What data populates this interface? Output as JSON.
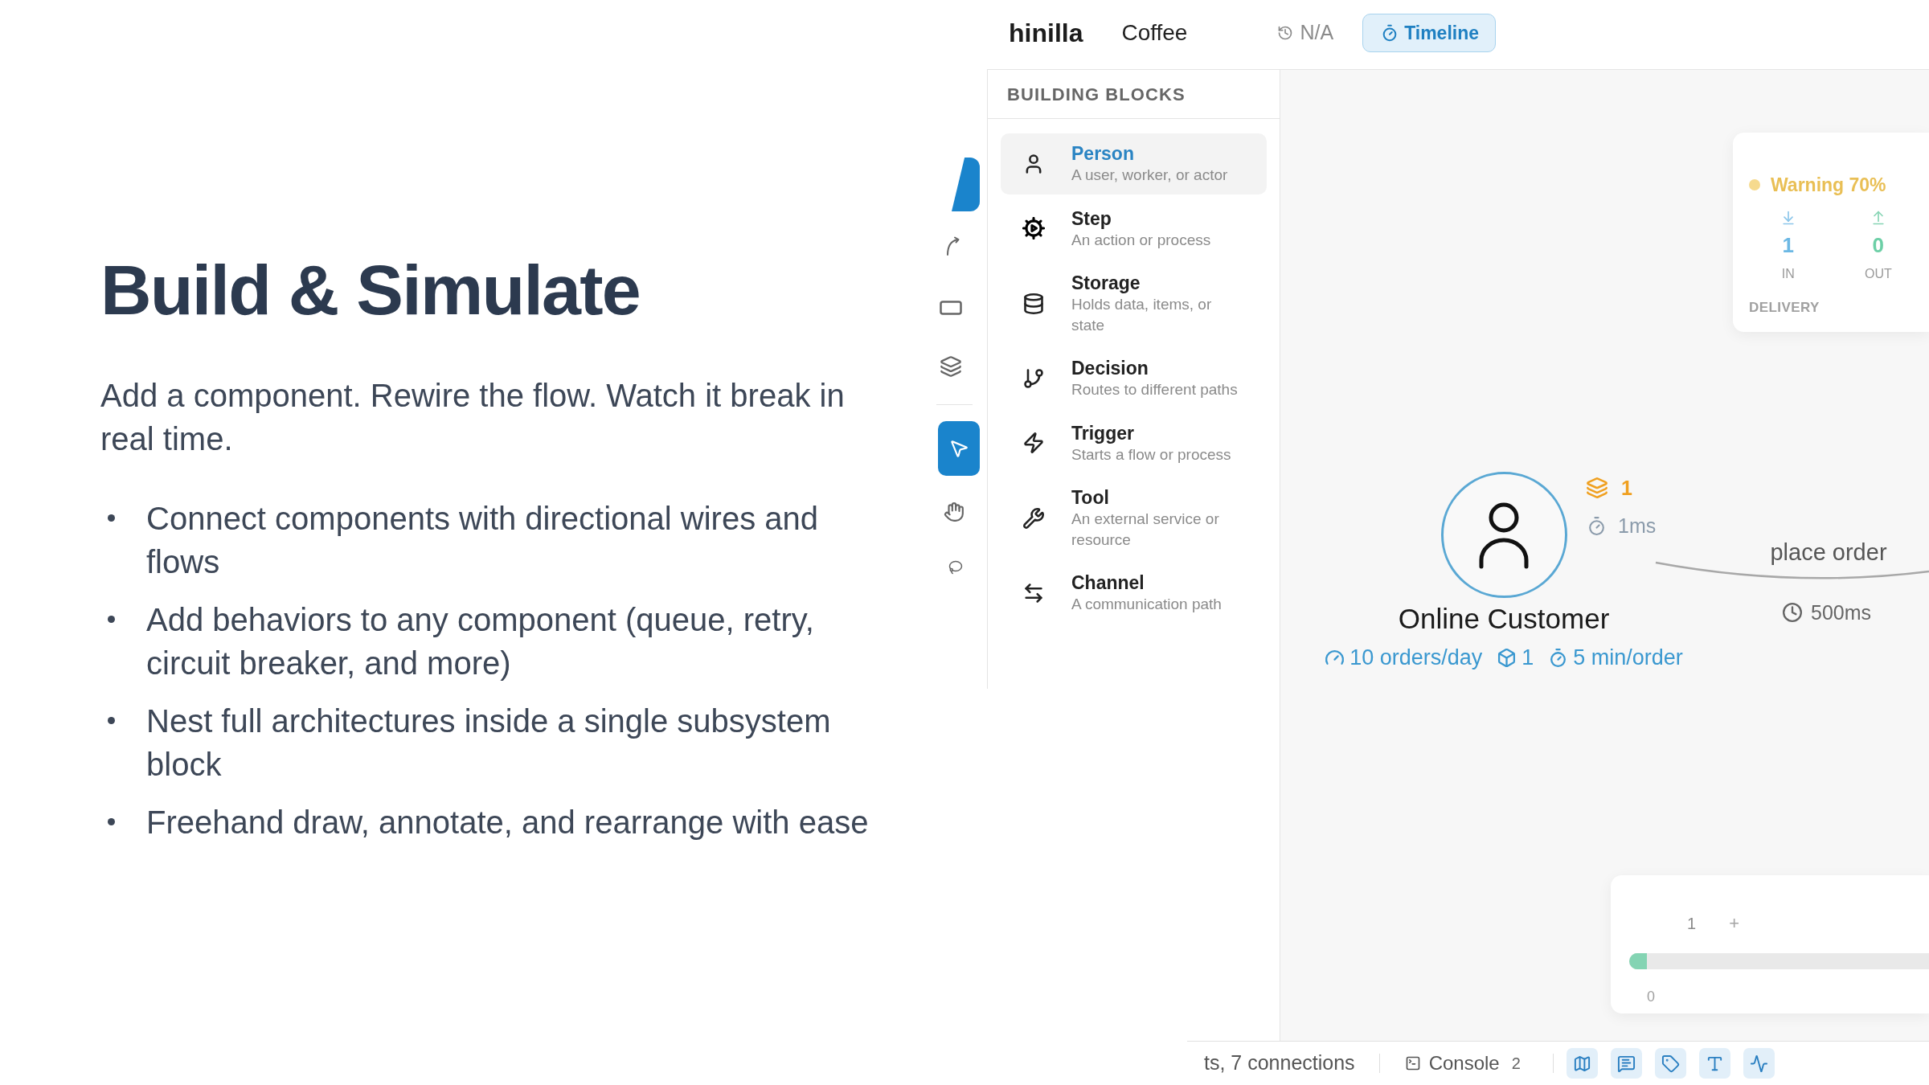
{
  "intro": {
    "title": "Build & Simulate",
    "lead": "Add a component. Rewire the flow. Watch it break in real time.",
    "bullets": [
      "Connect components with directional wires and flows",
      "Add behaviors to any component (queue, retry, circuit breaker, and more)",
      "Nest full architectures inside a single subsystem block",
      "Freehand draw, annotate, and rearrange with ease"
    ]
  },
  "app": {
    "top_bar": {
      "brand": "hinilla",
      "project": "Coffee",
      "history": "N/A",
      "timeline": {
        "label": "Timeline",
        "selected": true
      }
    },
    "toolbar": {
      "tools": [
        {
          "selected": true
        },
        {
          "selected": false
        },
        {
          "selected": false
        },
        {
          "selected": false
        },
        {
          "selected": true
        },
        {
          "selected": false
        },
        {
          "selected": false
        }
      ]
    },
    "building_blocks": {
      "title": "BUILDING BLOCKS",
      "items": [
        {
          "title": "Person",
          "description": "A user, worker, or actor",
          "selected": true
        },
        {
          "title": "Step",
          "description": "An action or process",
          "selected": false
        },
        {
          "title": "Storage",
          "description": "Holds data, items, or state",
          "selected": false
        },
        {
          "title": "Decision",
          "description": "Routes to different paths",
          "selected": false
        },
        {
          "title": "Trigger",
          "description": "Starts a flow or process",
          "selected": false
        },
        {
          "title": "Tool",
          "description": "An external service or resource",
          "selected": false
        },
        {
          "title": "Channel",
          "description": "A communication path",
          "selected": false
        }
      ]
    },
    "canvas": {
      "status_card": {
        "status": {
          "kind": "warning",
          "label": "Warning 70%"
        },
        "in": {
          "value": "1",
          "label": "IN"
        },
        "out": {
          "value": "0",
          "label": "OUT"
        },
        "caption": "DELIVERY"
      },
      "node": {
        "name": "Online Customer",
        "queue": "1",
        "latency": "1ms",
        "stats": [
          {
            "kind": "rate",
            "text": "10 orders/day"
          },
          {
            "kind": "capacity",
            "text": "1"
          },
          {
            "kind": "duration",
            "text": "5 min/order"
          }
        ]
      },
      "edge": {
        "label": "place order",
        "delay": "500ms"
      },
      "timeline_card": {
        "count": "1",
        "add": "+",
        "level": 0.06,
        "start": "0"
      }
    },
    "status_bar": {
      "summary": "ts, 7 connections",
      "console": {
        "label": "Console",
        "count": "2"
      },
      "toggles": [
        {
          "on": true
        },
        {
          "on": true
        },
        {
          "on": true
        },
        {
          "on": true
        },
        {
          "on": true
        }
      ]
    }
  }
}
